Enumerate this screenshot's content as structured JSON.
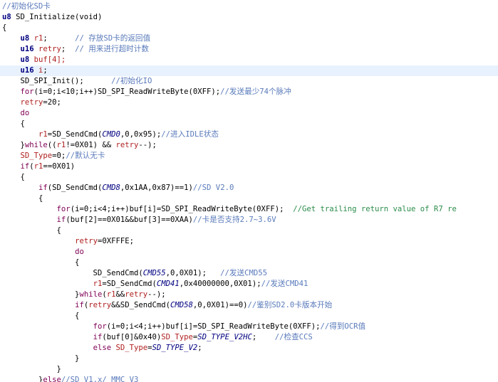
{
  "editor": {
    "highlight_color": "#e8f2fe",
    "lines": [
      [
        {
          "t": "//初始化SD卡",
          "c": "cmz"
        }
      ],
      [
        {
          "t": "u8 ",
          "c": "ty"
        },
        {
          "t": "SD_Initialize(void)",
          "c": "fn"
        }
      ],
      [
        {
          "t": "{",
          "c": "op"
        }
      ],
      [
        {
          "t": "    "
        },
        {
          "t": "u8 ",
          "c": "ty"
        },
        {
          "t": "r1",
          "c": "var"
        },
        {
          "t": ";      "
        },
        {
          "t": "// 存放SD卡的返回值",
          "c": "cmz"
        }
      ],
      [
        {
          "t": "    "
        },
        {
          "t": "u16 ",
          "c": "ty"
        },
        {
          "t": "retry",
          "c": "var"
        },
        {
          "t": ";  "
        },
        {
          "t": "// 用来进行超时计数",
          "c": "cmz"
        }
      ],
      [
        {
          "t": "    "
        },
        {
          "t": "u8 ",
          "c": "ty"
        },
        {
          "t": "buf[4];",
          "c": "var"
        }
      ],
      [
        {
          "t": "    "
        },
        {
          "t": "u16 ",
          "c": "ty"
        },
        {
          "t": "i",
          "c": "var"
        },
        {
          "t": ";"
        }
      ],
      [
        {
          "t": "    SD_SPI_Init();      "
        },
        {
          "t": "//初始化IO",
          "c": "cmz"
        }
      ],
      [
        {
          "t": "    "
        },
        {
          "t": "for",
          "c": "kw"
        },
        {
          "t": "(i=0;i<10;i++)SD_SPI_ReadWriteByte(0XFF);"
        },
        {
          "t": "//发送最少74个脉冲",
          "c": "cmz"
        }
      ],
      [
        {
          "t": "    "
        },
        {
          "t": "retry",
          "c": "var"
        },
        {
          "t": "=20;"
        }
      ],
      [
        {
          "t": "    "
        },
        {
          "t": "do",
          "c": "kw"
        }
      ],
      [
        {
          "t": "    {"
        }
      ],
      [
        {
          "t": "        "
        },
        {
          "t": "r1",
          "c": "var"
        },
        {
          "t": "=SD_SendCmd("
        },
        {
          "t": "CMD0",
          "c": "mac"
        },
        {
          "t": ",0,0x95);"
        },
        {
          "t": "//进入IDLE状态",
          "c": "cmz"
        }
      ],
      [
        {
          "t": "    }"
        },
        {
          "t": "while",
          "c": "kw"
        },
        {
          "t": "(("
        },
        {
          "t": "r1",
          "c": "var"
        },
        {
          "t": "!=0X01) && "
        },
        {
          "t": "retry",
          "c": "var"
        },
        {
          "t": "--);"
        }
      ],
      [
        {
          "t": "    "
        },
        {
          "t": "SD_Type",
          "c": "var"
        },
        {
          "t": "=0;"
        },
        {
          "t": "//默认无卡",
          "c": "cmz"
        }
      ],
      [
        {
          "t": "    "
        },
        {
          "t": "if",
          "c": "kw"
        },
        {
          "t": "("
        },
        {
          "t": "r1",
          "c": "var"
        },
        {
          "t": "==0X01)"
        }
      ],
      [
        {
          "t": "    {"
        }
      ],
      [
        {
          "t": "        "
        },
        {
          "t": "if",
          "c": "kw"
        },
        {
          "t": "(SD_SendCmd("
        },
        {
          "t": "CMD8",
          "c": "mac"
        },
        {
          "t": ",0x1AA,0x87)==1)"
        },
        {
          "t": "//SD V2.0",
          "c": "cmz"
        }
      ],
      [
        {
          "t": "        {"
        }
      ],
      [
        {
          "t": "            "
        },
        {
          "t": "for",
          "c": "kw"
        },
        {
          "t": "(i=0;i<4;i++)buf[i]=SD_SPI_ReadWriteByte(0XFF);  "
        },
        {
          "t": "//Get trailing return value of R7 re",
          "c": "cm"
        }
      ],
      [
        {
          "t": "            "
        },
        {
          "t": "if",
          "c": "kw"
        },
        {
          "t": "(buf[2]==0X01&&buf[3]==0XAA)"
        },
        {
          "t": "//卡是否支持2.7~3.6V",
          "c": "cmz"
        }
      ],
      [
        {
          "t": "            {"
        }
      ],
      [
        {
          "t": "                "
        },
        {
          "t": "retry",
          "c": "var"
        },
        {
          "t": "=0XFFFE;"
        }
      ],
      [
        {
          "t": "                "
        },
        {
          "t": "do",
          "c": "kw"
        }
      ],
      [
        {
          "t": "                {"
        }
      ],
      [
        {
          "t": "                    SD_SendCmd("
        },
        {
          "t": "CMD55",
          "c": "mac"
        },
        {
          "t": ",0,0X01);   "
        },
        {
          "t": "//发送CMD55",
          "c": "cmz"
        }
      ],
      [
        {
          "t": "                    "
        },
        {
          "t": "r1",
          "c": "var"
        },
        {
          "t": "=SD_SendCmd("
        },
        {
          "t": "CMD41",
          "c": "mac"
        },
        {
          "t": ",0x40000000,0X01);"
        },
        {
          "t": "//发送CMD41",
          "c": "cmz"
        }
      ],
      [
        {
          "t": "                }"
        },
        {
          "t": "while",
          "c": "kw"
        },
        {
          "t": "("
        },
        {
          "t": "r1",
          "c": "var"
        },
        {
          "t": "&&"
        },
        {
          "t": "retry",
          "c": "var"
        },
        {
          "t": "--);"
        }
      ],
      [
        {
          "t": "                "
        },
        {
          "t": "if",
          "c": "kw"
        },
        {
          "t": "("
        },
        {
          "t": "retry",
          "c": "var"
        },
        {
          "t": "&&SD_SendCmd("
        },
        {
          "t": "CMD58",
          "c": "mac"
        },
        {
          "t": ",0,0X01)==0)"
        },
        {
          "t": "//鉴别SD2.0卡版本开始",
          "c": "cmz"
        }
      ],
      [
        {
          "t": "                {"
        }
      ],
      [
        {
          "t": "                    "
        },
        {
          "t": "for",
          "c": "kw"
        },
        {
          "t": "(i=0;i<4;i++)buf[i]=SD_SPI_ReadWriteByte(0XFF);"
        },
        {
          "t": "//得到OCR值",
          "c": "cmz"
        }
      ],
      [
        {
          "t": "                    "
        },
        {
          "t": "if",
          "c": "kw"
        },
        {
          "t": "(buf[0]&0x40)"
        },
        {
          "t": "SD_Type",
          "c": "var"
        },
        {
          "t": "="
        },
        {
          "t": "SD_TYPE_V2HC",
          "c": "mac"
        },
        {
          "t": ";    "
        },
        {
          "t": "//检查CCS",
          "c": "cmz"
        }
      ],
      [
        {
          "t": "                    "
        },
        {
          "t": "else ",
          "c": "kw"
        },
        {
          "t": "SD_Type",
          "c": "var"
        },
        {
          "t": "="
        },
        {
          "t": "SD_TYPE_V2",
          "c": "mac"
        },
        {
          "t": ";"
        }
      ],
      [
        {
          "t": "                }"
        }
      ],
      [
        {
          "t": "            }"
        }
      ],
      [
        {
          "t": "        }"
        },
        {
          "t": "else",
          "c": "kw"
        },
        {
          "t": "//SD V1.x/ MMC V3",
          "c": "cmz"
        }
      ]
    ],
    "highlight_line": 6
  }
}
